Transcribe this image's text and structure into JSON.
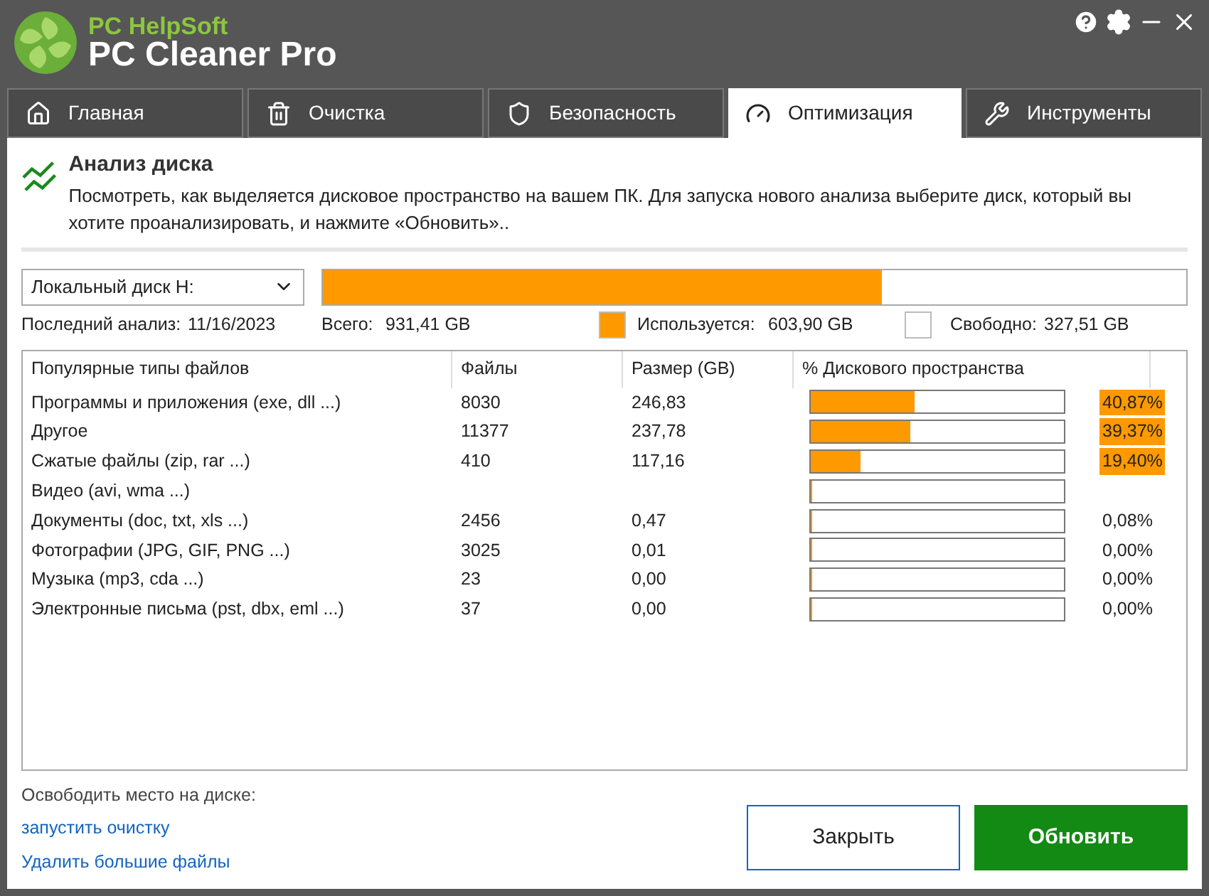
{
  "app": {
    "brand": "PC HelpSoft",
    "title": "PC Cleaner Pro"
  },
  "tabs": [
    {
      "label": "Главная",
      "selected": false
    },
    {
      "label": "Очистка",
      "selected": false
    },
    {
      "label": "Безопасность",
      "selected": false
    },
    {
      "label": "Оптимизация",
      "selected": true
    },
    {
      "label": "Инструменты",
      "selected": false
    }
  ],
  "section": {
    "title": "Анализ диска",
    "description": "Посмотреть, как выделяется дисковое пространство на вашем ПК. Для запуска нового анализа выберите диск, который вы хотите проанализировать, и нажмите «Обновить».."
  },
  "disk": {
    "selected_drive": "Локальный диск H:",
    "level": 0.648,
    "last_analysis_label": "Последний анализ:",
    "last_analysis": "11/16/2023",
    "total_label": "Всего:",
    "total": "931,41 GB",
    "used_label": "Используется:",
    "used": "603,90 GB",
    "free_label": "Свободно:",
    "free": "327,51 GB"
  },
  "table": {
    "columns": [
      "Популярные типы файлов",
      "Файлы",
      "Размер (GB)",
      "% Дискового пространства"
    ],
    "rows": [
      {
        "type": "Программы и приложения (exe, dll ...)",
        "files": "8030",
        "size": "246,83",
        "level": 0.4087,
        "percent": "40,87%",
        "highlighted": true
      },
      {
        "type": "Другое",
        "files": "11377",
        "size": "237,78",
        "level": 0.3937,
        "percent": "39,37%",
        "highlighted": true
      },
      {
        "type": "Сжатые файлы (zip, rar ...)",
        "files": "410",
        "size": "117,16",
        "level": 0.194,
        "percent": "19,40%",
        "highlighted": true
      },
      {
        "type": "Видео (avi, wma ...)",
        "level": 0
      },
      {
        "type": "Документы (doc, txt, xls ...)",
        "files": "2456",
        "size": "0,47",
        "level": 0.0008,
        "percent": "0,08%",
        "highlighted": false
      },
      {
        "type": "Фотографии (JPG, GIF, PNG ...)",
        "files": "3025",
        "size": "0,01",
        "level": 0,
        "percent": "0,00%",
        "highlighted": false
      },
      {
        "type": "Музыка (mp3, cda ...)",
        "files": "23",
        "size": "0,00",
        "level": 0,
        "percent": "0,00%",
        "highlighted": false
      },
      {
        "type": "Электронные письма (pst, dbx, eml ...)",
        "files": "37",
        "size": "0,00",
        "level": 0,
        "percent": "0,00%",
        "highlighted": false
      }
    ]
  },
  "footer": {
    "label": "Освободить место на диске:",
    "links": [
      "запустить очистку",
      "Удалить большие файлы"
    ],
    "buttons": [
      {
        "label": "Закрыть",
        "kind": "secondary"
      },
      {
        "label": "Обновить",
        "kind": "primary"
      }
    ]
  }
}
